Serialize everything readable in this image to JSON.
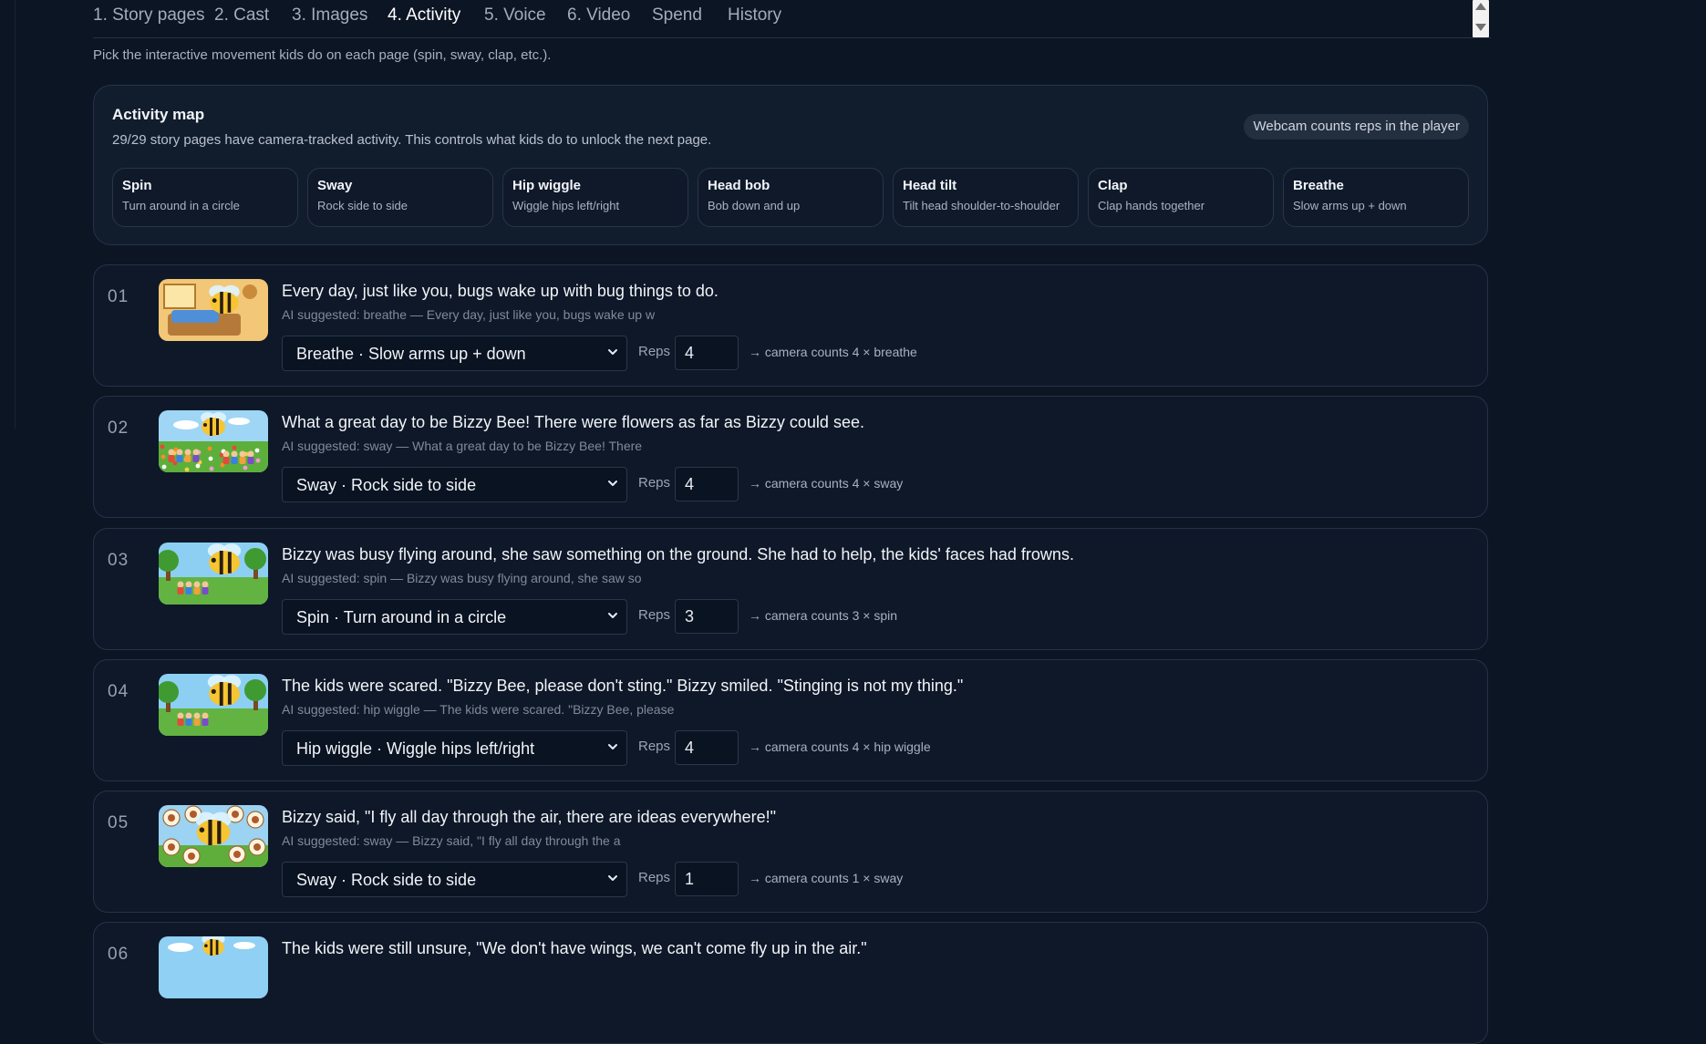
{
  "tabs": [
    {
      "label": "1. Story pages"
    },
    {
      "label": "2. Cast"
    },
    {
      "label": "3. Images"
    },
    {
      "label": "4. Activity",
      "active": true
    },
    {
      "label": "5. Voice"
    },
    {
      "label": "6. Video"
    },
    {
      "label": "Spend"
    },
    {
      "label": "History"
    }
  ],
  "intro": "Pick the interactive movement kids do on each page (spin, sway, clap, etc.).",
  "activity_map": {
    "title": "Activity map",
    "subtitle": "29/29 story pages have camera-tracked activity. This controls what kids do to unlock the next page.",
    "badge": "Webcam counts reps in the player",
    "moves": [
      {
        "name": "Spin",
        "desc": "Turn around in a circle"
      },
      {
        "name": "Sway",
        "desc": "Rock side to side"
      },
      {
        "name": "Hip wiggle",
        "desc": "Wiggle hips left/right"
      },
      {
        "name": "Head bob",
        "desc": "Bob down and up"
      },
      {
        "name": "Head tilt",
        "desc": "Tilt head shoulder-to-shoulder"
      },
      {
        "name": "Clap",
        "desc": "Clap hands together"
      },
      {
        "name": "Breathe",
        "desc": "Slow arms up + down"
      }
    ]
  },
  "reps_label": "Reps",
  "pages": [
    {
      "num": "01",
      "text": "Every day, just like you, bugs wake up with bug things to do.",
      "ai_note": "AI suggested: breathe — Every day, just like you, bugs wake up w",
      "activity": "Breathe · Slow arms up + down",
      "reps": "4",
      "camera_note": "→ camera counts 4 × breathe",
      "thumb": "bedroom"
    },
    {
      "num": "02",
      "text": "What a great day to be Bizzy Bee! There were flowers as far as Bizzy could see.",
      "ai_note": "AI suggested: sway — What a great day to be Bizzy Bee! There",
      "activity": "Sway · Rock side to side",
      "reps": "4",
      "camera_note": "→ camera counts 4 × sway",
      "thumb": "meadow"
    },
    {
      "num": "03",
      "text": "Bizzy was busy flying around, she saw something on the ground. She had to help, the kids' faces had frowns.",
      "ai_note": "AI suggested: spin — Bizzy was busy flying around, she saw so",
      "activity": "Spin · Turn around in a circle",
      "reps": "3",
      "camera_note": "→ camera counts 3 × spin",
      "thumb": "park"
    },
    {
      "num": "04",
      "text": "The kids were scared. \"Bizzy Bee, please don't sting.\" Bizzy smiled. \"Stinging is not my thing.\"",
      "ai_note": "AI suggested: hip wiggle — The kids were scared. \"Bizzy Bee, please",
      "activity": "Hip wiggle · Wiggle hips left/right",
      "reps": "4",
      "camera_note": "→ camera counts 4 × hip wiggle",
      "thumb": "park"
    },
    {
      "num": "05",
      "text": "Bizzy said, \"I fly all day through the air, there are ideas everywhere!\"",
      "ai_note": "AI suggested: sway — Bizzy said, \"I fly all day through the a",
      "activity": "Sway · Rock side to side",
      "reps": "1",
      "camera_note": "→ camera counts 1 × sway",
      "thumb": "ideas"
    },
    {
      "num": "06",
      "text": "The kids were still unsure, \"We don't have wings, we can't come fly up in the air.\"",
      "ai_note": "",
      "activity": "",
      "reps": "",
      "camera_note": "",
      "thumb": "sky"
    }
  ],
  "colors": {
    "background": "#0c1524",
    "card": "#0e1828",
    "border": "#263248",
    "text": "#f1f4f8",
    "muted": "#7f8a9a"
  }
}
